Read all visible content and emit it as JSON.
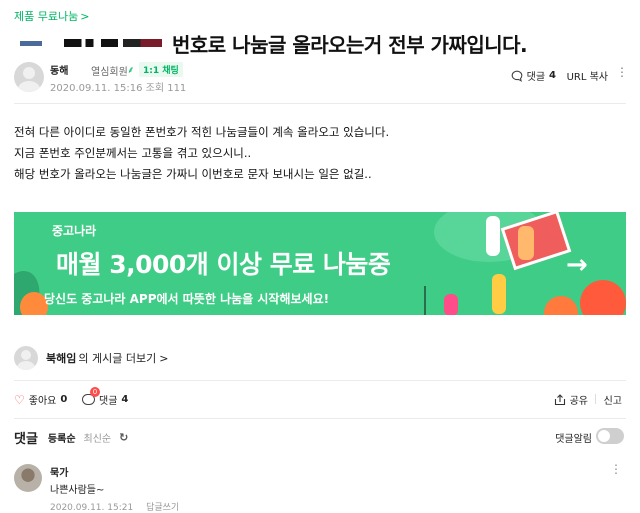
{
  "breadcrumb": {
    "label": "제품 무료나눔",
    "chevron": ">"
  },
  "post": {
    "title": "번호로 나눔글 올라오는거 전부 가짜입니다.",
    "author": {
      "nickname": "동해",
      "level": "열심회원",
      "chat_badge": "1:1 채팅"
    },
    "date": "2020.09.11. 15:16",
    "views_label": "조회 111",
    "comment_label": "댓글",
    "comment_count": "4",
    "url_copy": "URL 복사",
    "body": [
      "전혀 다른 아이디로 동일한 폰번호가 적힌 나눔글들이 계속 올라오고 있습니다.",
      "지금 폰번호 주인분께서는 고통을 겪고 있으시니..",
      "해당 번호가 올라오는 나눔글은 가짜니 이번호로 문자 보내시는 일은 없길.."
    ]
  },
  "banner": {
    "brand": "중고나라",
    "headline": "매월 3,000개 이상 무료 나눔중",
    "sub": "당신도 중고나라 APP에서 따뜻한 나눔을 시작해보세요!",
    "arrow": "→",
    "color": "#3fcc86"
  },
  "author_posts": {
    "name": "북해임",
    "text": "의 게시글 더보기",
    "chevron": ">"
  },
  "actions": {
    "like_label": "좋아요",
    "like_count": "0",
    "comment_label": "댓글",
    "comment_count": "4",
    "comment_badge": "0",
    "share_label": "공유",
    "report_label": "신고"
  },
  "comments": {
    "title": "댓글",
    "sort_registered": "등록순",
    "sort_latest": "최신순",
    "alarm_label": "댓글알림",
    "items": [
      {
        "name": "묵가",
        "text": "나쁜사람들~",
        "date": "2020.09.11. 15:21",
        "reply": "답글쓰기"
      }
    ]
  },
  "colors": {
    "accent": "#01b564",
    "like": "#ff4b4b"
  },
  "icons": [
    "chevron-right-icon",
    "leaf-icon",
    "comment-icon",
    "more-vertical-icon",
    "heart-icon",
    "share-icon",
    "refresh-icon",
    "toggle-icon"
  ]
}
